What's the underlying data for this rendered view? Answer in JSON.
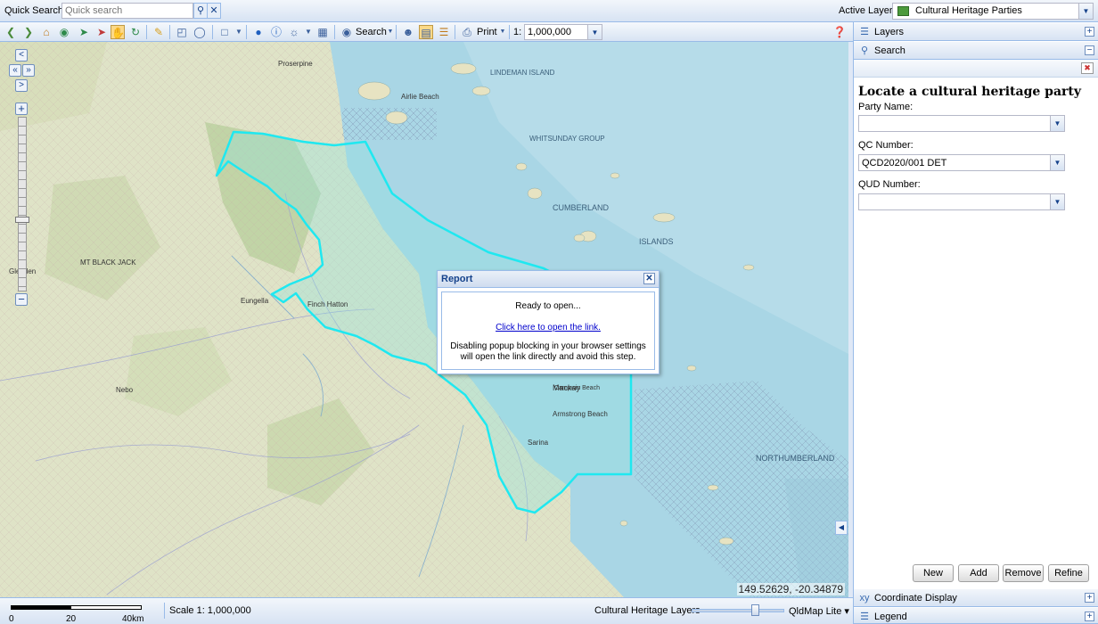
{
  "topbar": {
    "quick_search_label": "Quick Search:",
    "quick_search_placeholder": "Quick search",
    "active_layer_label": "Active Layer:",
    "active_layer_value": "Cultural Heritage Parties"
  },
  "toolbar": {
    "search_label": "Search",
    "print_label": "Print",
    "scale_prefix": "1:",
    "scale_value": "1,000,000"
  },
  "popup": {
    "title": "Report",
    "line1": "Ready to open...",
    "link": "Click here to open the link.",
    "line3a": "Disabling popup blocking in your browser settings",
    "line3b": "will open the link directly and avoid this step."
  },
  "map": {
    "coordinates": "149.52629, -20.34879",
    "labels": {
      "proserpine": "Proserpine",
      "airlie": "Airlie Beach",
      "whitsunday": "WHITSUNDAY GROUP",
      "lindeman": "LINDEMAN ISLAND",
      "cumberland": "CUMBERLAND",
      "islands": "ISLANDS",
      "northumberland": "NORTHUMBERLAND",
      "mackay": "Mackay",
      "sarina": "Sarina",
      "pinch": "Finch Hatton",
      "eungella": "Eungella",
      "nebo": "Nebo",
      "glenden": "Glenden",
      "blackjack": "MT BLACK JACK",
      "armstrong": "Armstrong Beach",
      "campwin": "Campwin Beach"
    }
  },
  "statusbar": {
    "scale_ticks": [
      "0",
      "20",
      "40km"
    ],
    "scale_text": "Scale 1: 1,000,000",
    "layers_label": "Cultural Heritage Layers",
    "basemap": "QldMap Lite"
  },
  "panel": {
    "layers_title": "Layers",
    "search_title": "Search",
    "form_title": "Locate a cultural heritage party",
    "party_name_label": "Party Name:",
    "party_name_value": "",
    "qc_label": "QC Number:",
    "qc_value": "QCD2020/001 DET",
    "qud_label": "QUD Number:",
    "qud_value": "",
    "buttons": {
      "new": "New",
      "add": "Add",
      "remove": "Remove",
      "refine": "Refine"
    },
    "coord_display_title": "Coordinate Display",
    "legend_title": "Legend"
  }
}
